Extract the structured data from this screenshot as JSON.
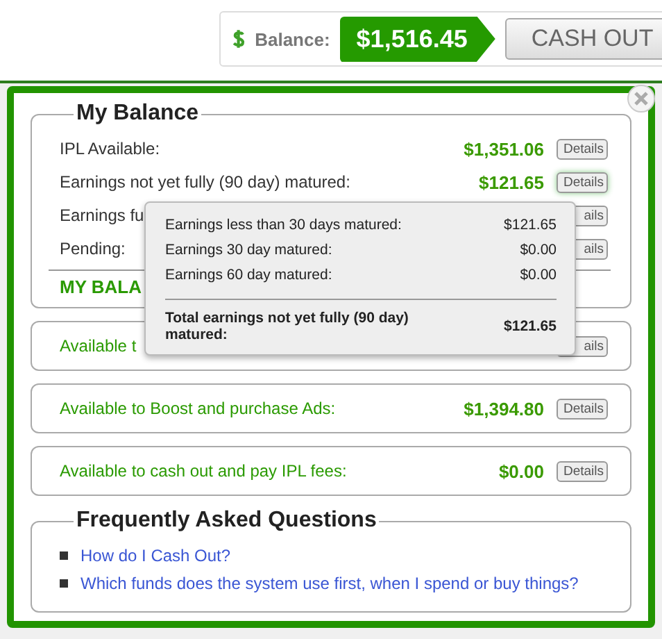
{
  "header": {
    "balance_label": "Balance:",
    "balance_amount": "$1,516.45",
    "cash_out_button": "CASH OUT"
  },
  "balance_section": {
    "title": "My Balance",
    "rows": [
      {
        "label": "IPL Available:",
        "amount": "$1,351.06",
        "details": "Details",
        "hovered": false
      },
      {
        "label": "Earnings not yet fully (90 day) matured:",
        "amount": "$121.65",
        "details": "Details",
        "hovered": true
      },
      {
        "label": "Earnings fu",
        "details": "ails",
        "hovered": false
      },
      {
        "label": "Pending:",
        "details": "ails",
        "hovered": false
      }
    ],
    "total_label": "MY BALA"
  },
  "summary_boxes": [
    {
      "label": "Available t",
      "details": "ails"
    },
    {
      "label": "Available to Boost and purchase Ads:",
      "amount": "$1,394.80",
      "details": "Details"
    },
    {
      "label": "Available to cash out and pay IPL fees:",
      "amount": "$0.00",
      "details": "Details"
    }
  ],
  "tooltip": {
    "rows": [
      {
        "label": "Earnings less than 30 days matured:",
        "amount": "$121.65"
      },
      {
        "label": "Earnings 30 day matured:",
        "amount": "$0.00"
      },
      {
        "label": "Earnings 60 day matured:",
        "amount": "$0.00"
      }
    ],
    "total_label": "Total earnings not yet fully (90 day) matured:",
    "total_amount": "$121.65"
  },
  "faq": {
    "title": "Frequently Asked Questions",
    "links": [
      "How do I Cash Out?",
      "Which funds does the system use first, when I spend or buy things?"
    ]
  }
}
